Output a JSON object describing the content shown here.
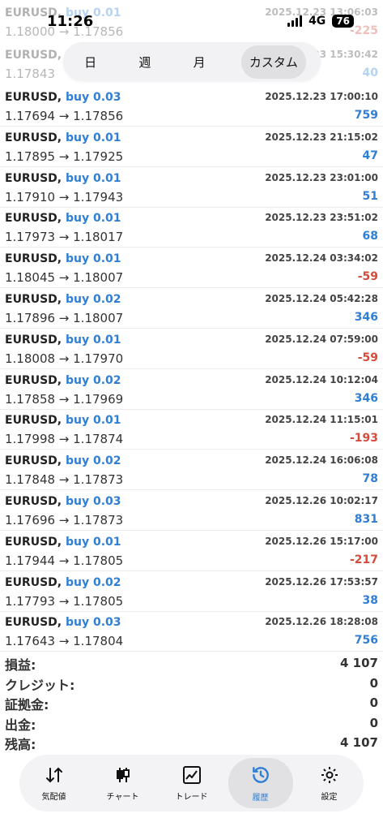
{
  "status": {
    "time": "11:26",
    "network": "4G",
    "battery": "76"
  },
  "period_tabs": [
    {
      "label": "日",
      "active": false
    },
    {
      "label": "週",
      "active": false
    },
    {
      "label": "月",
      "active": false
    },
    {
      "label": "カスタム",
      "active": true
    }
  ],
  "ghost_rows": [
    {
      "symbol": "EURUSD,",
      "side": "buy 0.01",
      "date": "2025.12.23 13:06:03",
      "prices": "1.18000 → 1.17856",
      "profit": "-225"
    },
    {
      "symbol": "EURUSD,",
      "side": "",
      "date": "23 15:30:42",
      "prices": "1.17843",
      "profit": "40"
    }
  ],
  "trades": [
    {
      "symbol": "EURUSD,",
      "side": "buy 0.03",
      "date": "2025.12.23 17:00:10",
      "prices": "1.17694 → 1.17856",
      "profit": "759",
      "positive": true
    },
    {
      "symbol": "EURUSD,",
      "side": "buy 0.01",
      "date": "2025.12.23 21:15:02",
      "prices": "1.17895 → 1.17925",
      "profit": "47",
      "positive": true
    },
    {
      "symbol": "EURUSD,",
      "side": "buy 0.01",
      "date": "2025.12.23 23:01:00",
      "prices": "1.17910 → 1.17943",
      "profit": "51",
      "positive": true
    },
    {
      "symbol": "EURUSD,",
      "side": "buy 0.01",
      "date": "2025.12.23 23:51:02",
      "prices": "1.17973 → 1.18017",
      "profit": "68",
      "positive": true
    },
    {
      "symbol": "EURUSD,",
      "side": "buy 0.01",
      "date": "2025.12.24 03:34:02",
      "prices": "1.18045 → 1.18007",
      "profit": "-59",
      "positive": false
    },
    {
      "symbol": "EURUSD,",
      "side": "buy 0.02",
      "date": "2025.12.24 05:42:28",
      "prices": "1.17896 → 1.18007",
      "profit": "346",
      "positive": true
    },
    {
      "symbol": "EURUSD,",
      "side": "buy 0.01",
      "date": "2025.12.24 07:59:00",
      "prices": "1.18008 → 1.17970",
      "profit": "-59",
      "positive": false
    },
    {
      "symbol": "EURUSD,",
      "side": "buy 0.02",
      "date": "2025.12.24 10:12:04",
      "prices": "1.17858 → 1.17969",
      "profit": "346",
      "positive": true
    },
    {
      "symbol": "EURUSD,",
      "side": "buy 0.01",
      "date": "2025.12.24 11:15:01",
      "prices": "1.17998 → 1.17874",
      "profit": "-193",
      "positive": false
    },
    {
      "symbol": "EURUSD,",
      "side": "buy 0.02",
      "date": "2025.12.24 16:06:08",
      "prices": "1.17848 → 1.17873",
      "profit": "78",
      "positive": true
    },
    {
      "symbol": "EURUSD,",
      "side": "buy 0.03",
      "date": "2025.12.26 10:02:17",
      "prices": "1.17696 → 1.17873",
      "profit": "831",
      "positive": true
    },
    {
      "symbol": "EURUSD,",
      "side": "buy 0.01",
      "date": "2025.12.26 15:17:00",
      "prices": "1.17944 → 1.17805",
      "profit": "-217",
      "positive": false
    },
    {
      "symbol": "EURUSD,",
      "side": "buy 0.02",
      "date": "2025.12.26 17:53:57",
      "prices": "1.17793 → 1.17805",
      "profit": "38",
      "positive": true
    },
    {
      "symbol": "EURUSD,",
      "side": "buy 0.03",
      "date": "2025.12.26 18:28:08",
      "prices": "1.17643 → 1.17804",
      "profit": "756",
      "positive": true
    }
  ],
  "summary": [
    {
      "label": "損益:",
      "value": "4 107"
    },
    {
      "label": "クレジット:",
      "value": "0"
    },
    {
      "label": "証拠金:",
      "value": "0"
    },
    {
      "label": "出金:",
      "value": "0"
    },
    {
      "label": "残高:",
      "value": "4 107"
    }
  ],
  "nav": [
    {
      "label": "気配値",
      "icon": "quotes-icon",
      "active": false
    },
    {
      "label": "チャート",
      "icon": "candlestick-icon",
      "active": false
    },
    {
      "label": "トレード",
      "icon": "trade-chart-icon",
      "active": false
    },
    {
      "label": "履歴",
      "icon": "history-clock-icon",
      "active": true
    },
    {
      "label": "設定",
      "icon": "gear-icon",
      "active": false
    }
  ],
  "colors": {
    "positive": "#2f7fd6",
    "negative": "#d64a3a",
    "accent": "#2f7fd6"
  }
}
